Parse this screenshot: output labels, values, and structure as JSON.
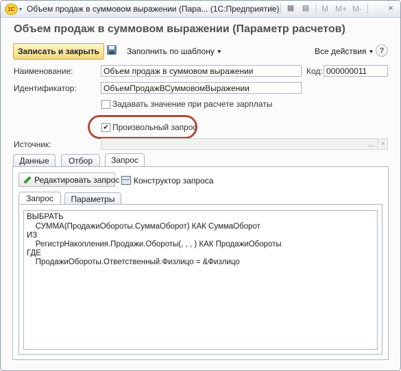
{
  "window": {
    "title": "Объем продаж в суммовом выражении (Пара... (1С:Предприятие)",
    "logo_text": "1С",
    "toolbar_right": [
      "M",
      "M+",
      "M-"
    ],
    "close": "×"
  },
  "form": {
    "title": "Объем продаж в суммовом выражении (Параметр расчетов)"
  },
  "command_bar": {
    "save_close": "Записать и закрыть",
    "fill_template": "Заполнить по шаблону",
    "all_actions": "Все действия",
    "help": "?"
  },
  "fields": {
    "name_label": "Наименование:",
    "name_value": "Объем продаж в суммовом выражении",
    "code_label": "Код:",
    "code_value": "000000011",
    "id_label": "Идентификатор:",
    "id_value": "ОбъемПродажВСуммовомВыражении",
    "salary_checkbox_label": "Задавать значение при расчете зарплаты",
    "salary_checked": false,
    "custom_query_label": "Произвольный запрос",
    "custom_query_checked": true,
    "source_label": "Источник:",
    "source_value": "",
    "source_button": "...",
    "source_clear": "×"
  },
  "tabs": [
    {
      "label": "Данные",
      "active": false
    },
    {
      "label": "Отбор",
      "active": false
    },
    {
      "label": "Запрос",
      "active": true
    }
  ],
  "query_panel": {
    "edit_button": "Редактировать запрос",
    "constructor_link": "Конструктор запроса",
    "subtabs": [
      {
        "label": "Запрос",
        "active": true
      },
      {
        "label": "Параметры",
        "active": false
      }
    ],
    "query_lines": [
      "ВЫБРАТЬ",
      "    СУММА(ПродажиОбороты.СуммаОборот) КАК СуммаОборот",
      "ИЗ",
      "    РегистрНакопления.Продажи.Обороты(, , , ) КАК ПродажиОбороты",
      "ГДЕ",
      "    ПродажиОбороты.Ответственный.Физлицо = &Физлицо"
    ]
  },
  "colors": {
    "highlight_ring": "#b44a38",
    "primary_button": "#f6d97a",
    "form_title": "#4f4f4f"
  }
}
